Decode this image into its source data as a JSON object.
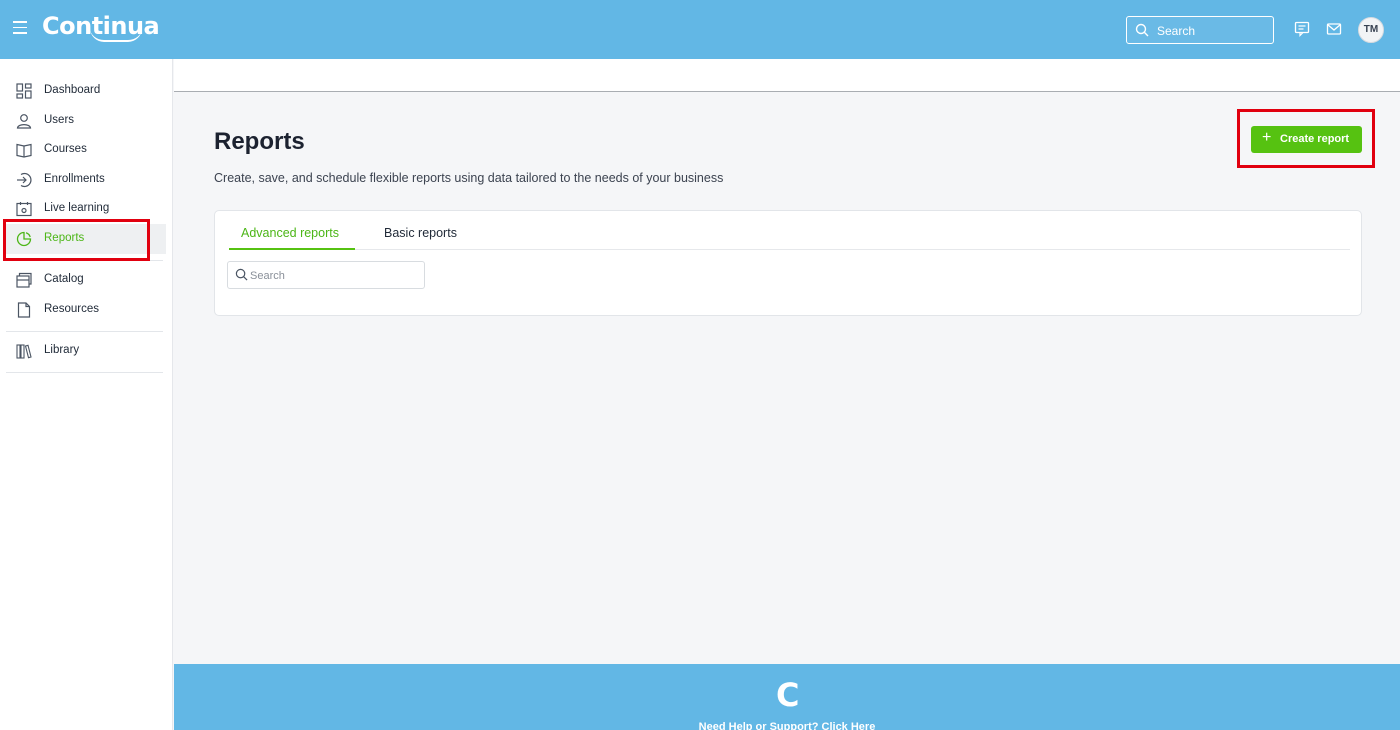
{
  "app": {
    "logo_text": "Continua"
  },
  "topbar": {
    "search_placeholder": "Search",
    "avatar_initials": "TM"
  },
  "sidebar": {
    "items": [
      {
        "label": "Dashboard",
        "icon": "dashboard-icon"
      },
      {
        "label": "Users",
        "icon": "user-icon"
      },
      {
        "label": "Courses",
        "icon": "book-icon"
      },
      {
        "label": "Enrollments",
        "icon": "enroll-icon"
      },
      {
        "label": "Live learning",
        "icon": "calendar-icon"
      },
      {
        "label": "Reports",
        "icon": "pie-chart-icon",
        "active": true
      },
      {
        "label": "Catalog",
        "icon": "catalog-icon"
      },
      {
        "label": "Resources",
        "icon": "file-icon"
      },
      {
        "label": "Library",
        "icon": "library-icon"
      }
    ]
  },
  "main": {
    "title": "Reports",
    "subtitle": "Create, save, and schedule flexible reports using data tailored to the needs of your business",
    "create_button": "Create report",
    "tabs": [
      {
        "label": "Advanced reports",
        "active": true
      },
      {
        "label": "Basic reports",
        "active": false
      }
    ],
    "search_placeholder": "Search"
  },
  "footer": {
    "logo_letter": "C",
    "help_text": "Need Help or Support? Click Here"
  },
  "colors": {
    "header": "#62b7e5",
    "accent_green": "#56c211",
    "highlight_red": "#e1000f"
  }
}
